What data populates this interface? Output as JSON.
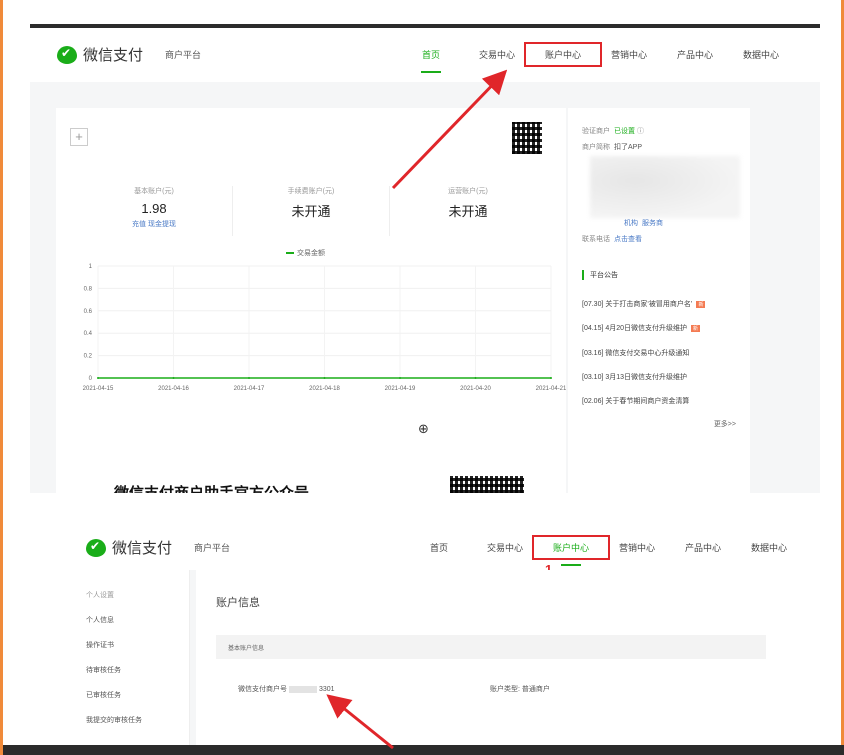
{
  "panel1": {
    "brand": "微信支付",
    "subtitle": "商户平台",
    "nav": [
      "首页",
      "交易中心",
      "账户中心",
      "营销中心",
      "产品中心",
      "数据中心"
    ],
    "stats": [
      {
        "label": "基本账户(元)",
        "value": "1.98",
        "links": "充值  现金提现"
      },
      {
        "label": "手续费账户(元)",
        "value": "未开通",
        "links": ""
      },
      {
        "label": "运营账户(元)",
        "value": "未开通",
        "links": ""
      }
    ],
    "legend": "交易金额",
    "chart_data": {
      "type": "line",
      "x": [
        "2021-04-15",
        "2021-04-16",
        "2021-04-17",
        "2021-04-18",
        "2021-04-19",
        "2021-04-20",
        "2021-04-21"
      ],
      "series": [
        {
          "values": [
            0,
            0,
            0,
            0,
            0,
            0,
            0
          ]
        }
      ],
      "yticks": [
        "0",
        "0.2",
        "0.4",
        "0.6",
        "0.8",
        "1"
      ],
      "ylim": [
        0,
        1
      ],
      "line_color": "#1aad19"
    },
    "promo_title": "微信支付商户助手官方公众号",
    "side": {
      "row1_label": "验证商户",
      "row1_value": "已设置",
      "row2_label": "商户简称",
      "row2_value": "扣了APP",
      "row3_label": "机构",
      "row3_value": "服务商",
      "row4_label": "联系电话",
      "row4_value": "点击查看",
      "notice_title": "平台公告",
      "notices": [
        {
          "text": "[07.30] 关于打击商家‘被冒用商户名’",
          "hot": "新"
        },
        {
          "text": "[04.15] 4月20日微信支付升级维护",
          "hot": "新"
        },
        {
          "text": "[03.16] 微信支付交易中心升级通知",
          "hot": ""
        },
        {
          "text": "[03.10] 3月13日微信支付升级维护",
          "hot": ""
        },
        {
          "text": "[02.06] 关于春节期间商户资金清算",
          "hot": ""
        }
      ],
      "more": "更多>>"
    }
  },
  "panel2": {
    "brand": "微信支付",
    "subtitle": "商户平台",
    "nav": [
      "首页",
      "交易中心",
      "账户中心",
      "营销中心",
      "产品中心",
      "数据中心"
    ],
    "step": "1",
    "sidebar": [
      "个人设置",
      "个人信息",
      "操作证书",
      "待审核任务",
      "已审核任务",
      "我提交的审核任务"
    ],
    "content_title": "账户信息",
    "section": "基本账户信息",
    "field1_label": "微信支付商户号",
    "field1_suffix": "3301",
    "field2_label": "账户类型:",
    "field2_value": "普通商户"
  },
  "colors": {
    "accent": "#1aad19",
    "highlight": "#e0262a",
    "link": "#4a7ac6"
  }
}
